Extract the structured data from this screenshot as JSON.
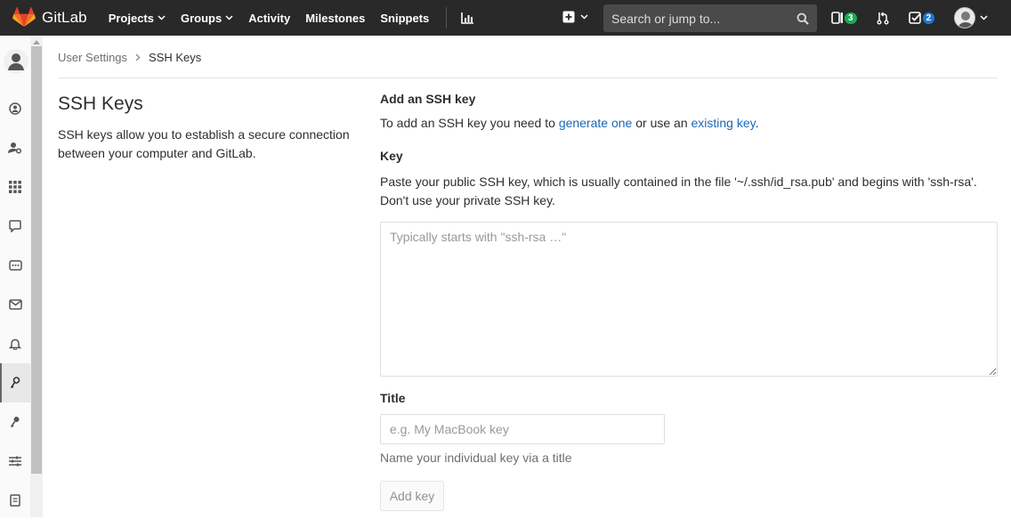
{
  "navbar": {
    "brand": "GitLab",
    "links": [
      {
        "label": "Projects",
        "caret": true
      },
      {
        "label": "Groups",
        "caret": true
      },
      {
        "label": "Activity",
        "caret": false
      },
      {
        "label": "Milestones",
        "caret": false
      },
      {
        "label": "Snippets",
        "caret": false
      }
    ],
    "search_placeholder": "Search or jump to...",
    "merge_requests_count": "3",
    "todos_count": "2"
  },
  "sidebar": {
    "items": [
      {
        "icon": "profile-icon"
      },
      {
        "icon": "account-icon"
      },
      {
        "icon": "applications-icon"
      },
      {
        "icon": "chat-icon"
      },
      {
        "icon": "access-tokens-icon"
      },
      {
        "icon": "emails-icon"
      },
      {
        "icon": "notifications-icon"
      },
      {
        "icon": "ssh-keys-icon",
        "active": true
      },
      {
        "icon": "gpg-keys-icon"
      },
      {
        "icon": "preferences-icon"
      },
      {
        "icon": "active-sessions-icon"
      }
    ]
  },
  "breadcrumb": {
    "parent": "User Settings",
    "current": "SSH Keys"
  },
  "left": {
    "title": "SSH Keys",
    "description": "SSH keys allow you to establish a secure connection between your computer and GitLab."
  },
  "form": {
    "heading": "Add an SSH key",
    "intro_prefix": "To add an SSH key you need to ",
    "intro_link1": "generate one",
    "intro_middle": " or use an ",
    "intro_link2": "existing key",
    "intro_suffix": ".",
    "key_label": "Key",
    "key_help": "Paste your public SSH key, which is usually contained in the file '~/.ssh/id_rsa.pub' and begins with 'ssh-rsa'. Don't use your private SSH key.",
    "key_placeholder": "Typically starts with \"ssh-rsa …\"",
    "key_value": "",
    "title_label": "Title",
    "title_placeholder": "e.g. My MacBook key",
    "title_value": "",
    "title_help": "Name your individual key via a title",
    "submit_label": "Add key"
  },
  "colors": {
    "navbar_bg": "#292929",
    "link": "#1b69b6",
    "badge_green": "#1aaa55",
    "badge_blue": "#1f78d1",
    "gitlab_orange": "#e24329"
  }
}
